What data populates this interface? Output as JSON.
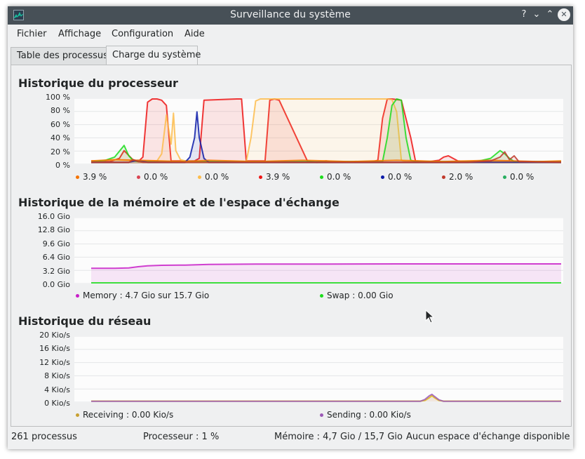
{
  "window": {
    "title": "Surveillance du système"
  },
  "titlebar": {
    "help": "?",
    "minimize": "⌄",
    "maximize": "⌃",
    "close": "✕"
  },
  "menu": [
    "Fichier",
    "Affichage",
    "Configuration",
    "Aide"
  ],
  "tabs": [
    {
      "label": "Table des processus",
      "active": false
    },
    {
      "label": "Charge du système",
      "active": true
    }
  ],
  "cpu": {
    "title": "Historique du processeur",
    "yticks": [
      "100 %",
      "80 %",
      "60 %",
      "40 %",
      "20 %",
      "0 %"
    ],
    "legend": [
      {
        "value": "3.9 %",
        "color": "#f67400"
      },
      {
        "value": "0.0 %",
        "color": "#da4453"
      },
      {
        "value": "0.0 %",
        "color": "#fdbc4b"
      },
      {
        "value": "3.9 %",
        "color": "#ed1515"
      },
      {
        "value": "0.0 %",
        "color": "#1cdc1c"
      },
      {
        "value": "0.0 %",
        "color": "#0b1aa8"
      },
      {
        "value": "2.0 %",
        "color": "#c0392b"
      },
      {
        "value": "0.0 %",
        "color": "#27ae60"
      }
    ]
  },
  "memory": {
    "title": "Historique de la mémoire et de l'espace d'échange",
    "yticks": [
      "16.0 Gio",
      "12.8 Gio",
      "9.6 Gio",
      "6.4 Gio",
      "3.2 Gio",
      "0.0 Gio"
    ],
    "legend": [
      {
        "label": "Memory : 4.7 Gio sur 15.7 Gio",
        "color": "#c81ec8"
      },
      {
        "label": "Swap : 0.00 Gio",
        "color": "#1cdc1c"
      }
    ]
  },
  "network": {
    "title": "Historique du réseau",
    "yticks": [
      "20 Kio/s",
      "16 Kio/s",
      "12 Kio/s",
      "8 Kio/s",
      "4 Kio/s",
      "0 Kio/s"
    ],
    "legend": [
      {
        "label": "Receiving : 0.00 Kio/s",
        "color": "#c8a032"
      },
      {
        "label": "Sending : 0.00 Kio/s",
        "color": "#9b59b6"
      }
    ]
  },
  "status": {
    "processes": "261 processus",
    "cpu": "Processeur : 1 %",
    "memory": "Mémoire : 4,7 Gio / 15,7 Gio",
    "swap": "Aucun espace d'échange disponible"
  },
  "chart_data": [
    {
      "type": "area",
      "title": "Historique du processeur",
      "ylim": [
        0,
        100
      ],
      "y_unit": "%",
      "grid": true,
      "series": [
        {
          "color": "#ed1515",
          "x": [
            0,
            4,
            6,
            7,
            9,
            10,
            11,
            12,
            13,
            14,
            15,
            16,
            17,
            22,
            23,
            24,
            31,
            32,
            33,
            37,
            38,
            39,
            40,
            46,
            47,
            48,
            49,
            50,
            51,
            60,
            61,
            62,
            63,
            64,
            66,
            68,
            69,
            72,
            73,
            74,
            75,
            76,
            77,
            78,
            80,
            82,
            84,
            86,
            88,
            90,
            100
          ],
          "y": [
            4,
            3,
            8,
            20,
            5,
            3,
            10,
            95,
            100,
            100,
            98,
            90,
            4,
            4,
            8,
            98,
            100,
            100,
            4,
            4,
            98,
            100,
            98,
            4,
            3,
            2,
            3,
            4,
            3,
            3,
            5,
            70,
            100,
            100,
            98,
            40,
            4,
            3,
            4,
            5,
            10,
            12,
            8,
            4,
            3,
            3,
            4,
            3,
            3,
            3,
            3
          ]
        },
        {
          "color": "#fdbc4b",
          "x": [
            0,
            5,
            10,
            14,
            15,
            16,
            17,
            17.5,
            18,
            19,
            20,
            24,
            25,
            26,
            33,
            34,
            35,
            36,
            37,
            40,
            63,
            64,
            65,
            66,
            67,
            70,
            75,
            85,
            100
          ],
          "y": [
            3,
            6,
            4,
            4,
            15,
            75,
            30,
            78,
            20,
            6,
            4,
            3,
            4,
            3,
            3,
            40,
            97,
            100,
            100,
            100,
            100,
            99,
            80,
            5,
            3,
            3,
            3,
            3,
            3
          ]
        },
        {
          "color": "#1cdc1c",
          "x": [
            0,
            3,
            5,
            7,
            8,
            9,
            10,
            12,
            40,
            62,
            63,
            64,
            65,
            66,
            67,
            68,
            69,
            70,
            82,
            85,
            87,
            88,
            89,
            90,
            100
          ],
          "y": [
            3,
            5,
            10,
            28,
            12,
            4,
            3,
            3,
            3,
            3,
            40,
            90,
            100,
            98,
            40,
            5,
            3,
            3,
            3,
            8,
            20,
            15,
            8,
            3,
            3
          ]
        },
        {
          "color": "#0b1aa8",
          "x": [
            0,
            8,
            10,
            12,
            13,
            20,
            21,
            22,
            22.5,
            23,
            24,
            25,
            100
          ],
          "y": [
            2,
            2,
            5,
            2,
            2,
            2,
            10,
            40,
            80,
            40,
            8,
            2,
            2
          ]
        },
        {
          "color": "#f67400",
          "x": [
            0,
            5,
            10,
            15,
            20,
            25,
            30,
            35,
            40,
            45,
            50,
            55,
            60,
            65,
            70,
            75,
            80,
            85,
            90,
            95,
            100
          ],
          "y": [
            4,
            6,
            5,
            4,
            3,
            5,
            4,
            3,
            4,
            5,
            4,
            3,
            4,
            5,
            4,
            3,
            4,
            5,
            4,
            3,
            4
          ]
        },
        {
          "color": "#c0392b",
          "x": [
            0,
            8,
            9,
            10,
            11,
            12,
            13,
            14,
            80,
            85,
            87,
            88,
            89,
            90,
            91,
            100
          ],
          "y": [
            2,
            2,
            6,
            3,
            2,
            2,
            2,
            2,
            2,
            4,
            10,
            18,
            6,
            12,
            3,
            2
          ]
        }
      ]
    },
    {
      "type": "area",
      "title": "Historique de la mémoire et de l'espace d'échange",
      "ylim": [
        0,
        16
      ],
      "y_unit": "Gio",
      "grid": true,
      "series": [
        {
          "name": "Memory",
          "color": "#c81ec8",
          "x": [
            0,
            5,
            8,
            10,
            12,
            15,
            20,
            25,
            35,
            50,
            65,
            80,
            100
          ],
          "y": [
            3.6,
            3.6,
            3.7,
            4.0,
            4.2,
            4.35,
            4.4,
            4.55,
            4.65,
            4.65,
            4.7,
            4.7,
            4.7
          ]
        },
        {
          "name": "Swap",
          "color": "#1cdc1c",
          "x": [
            0,
            100
          ],
          "y": [
            0,
            0
          ]
        }
      ]
    },
    {
      "type": "area",
      "title": "Historique du réseau",
      "ylim": [
        0,
        20
      ],
      "y_unit": "Kio/s",
      "grid": true,
      "series": [
        {
          "name": "Receiving",
          "color": "#e8c400",
          "x": [
            0,
            70,
            71,
            72,
            72.5,
            73,
            74,
            75,
            100
          ],
          "y": [
            0.1,
            0.1,
            0.3,
            1.2,
            1.8,
            1.2,
            0.3,
            0.1,
            0.1
          ]
        },
        {
          "name": "Sending",
          "color": "#9b59b6",
          "x": [
            0,
            70,
            71,
            72,
            72.5,
            73,
            74,
            75,
            100
          ],
          "y": [
            0.05,
            0.05,
            0.6,
            1.8,
            2.2,
            1.6,
            0.5,
            0.05,
            0.05
          ]
        }
      ]
    }
  ]
}
